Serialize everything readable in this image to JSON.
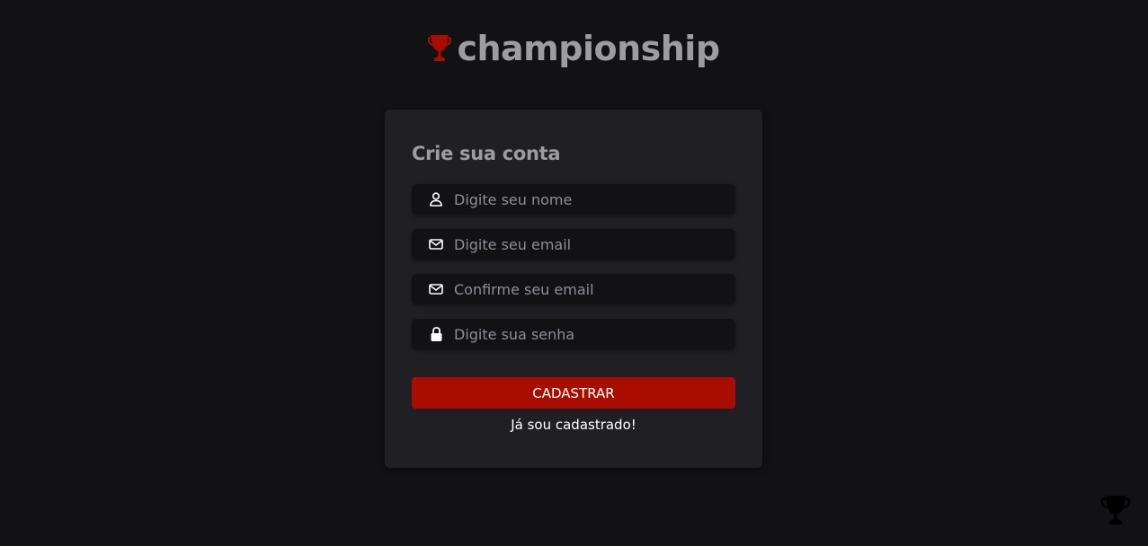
{
  "brand": {
    "name": "championship",
    "icon": "trophy-icon",
    "accent_color": "#a80d00"
  },
  "form": {
    "title": "Crie sua conta",
    "fields": [
      {
        "icon": "user-icon",
        "placeholder": "Digite seu nome",
        "value": ""
      },
      {
        "icon": "mail-icon",
        "placeholder": "Digite seu email",
        "value": ""
      },
      {
        "icon": "mail-icon",
        "placeholder": "Confirme seu email",
        "value": ""
      },
      {
        "icon": "lock-icon",
        "placeholder": "Digite sua senha",
        "value": ""
      }
    ],
    "submit_label": "CADASTRAR",
    "login_link": "Já sou cadastrado!"
  },
  "decor": {
    "corner_icon": "trophy-icon"
  }
}
